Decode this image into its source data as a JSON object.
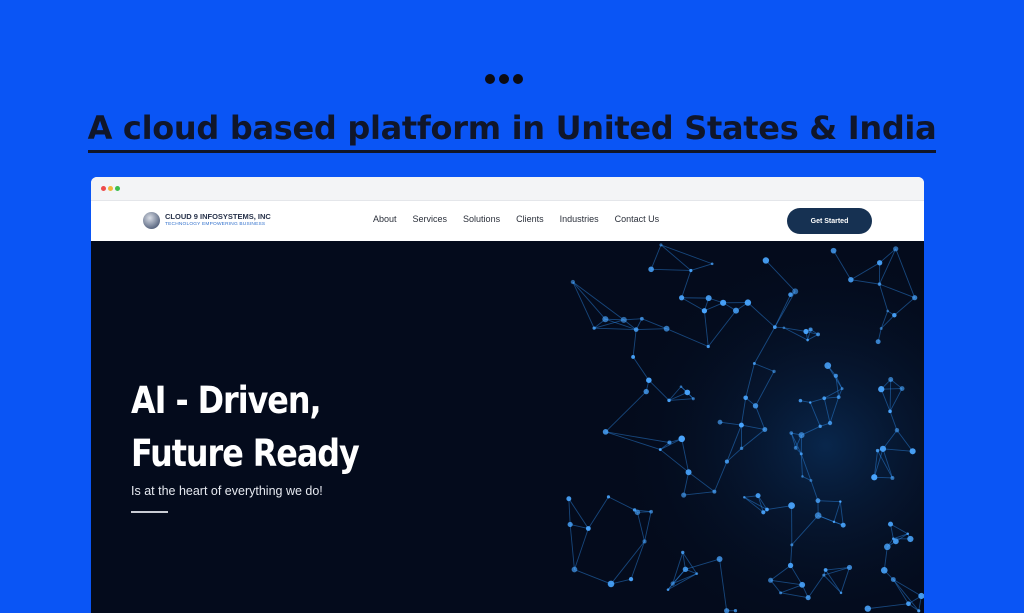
{
  "headline": "A cloud based platform in United States & India",
  "site": {
    "logo": {
      "name": "CLOUD 9 INFOSYSTEMS, INC",
      "tagline": "TECHNOLOGY EMPOWERING BUSINESS"
    },
    "nav": [
      "About",
      "Services",
      "Solutions",
      "Clients",
      "Industries",
      "Contact Us"
    ],
    "cta": "Get Started",
    "hero": {
      "title_line1": "AI - Driven,",
      "title_line2": "Future Ready",
      "subtitle": "Is at the heart of everything we do!"
    }
  },
  "icons": [
    "more-dots-icon",
    "globe-logo-icon"
  ],
  "colors": {
    "background": "#0a55f5",
    "headline": "#10162a",
    "hero_bg": "#040b1c",
    "network": "#2f8df0",
    "cta_bg": "#163152"
  }
}
